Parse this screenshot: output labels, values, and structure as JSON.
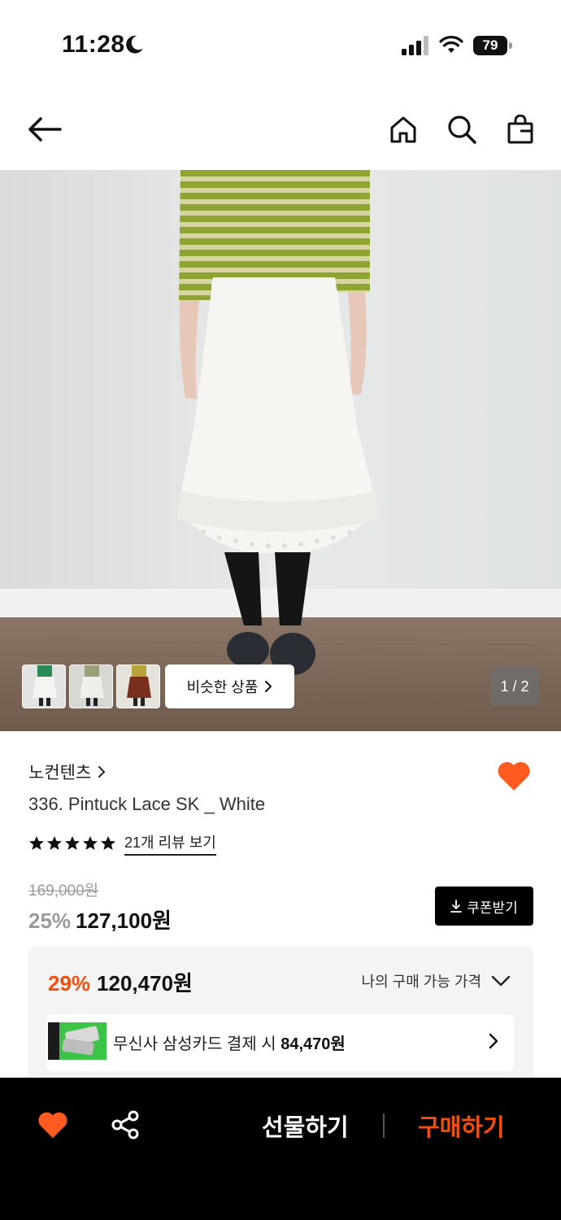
{
  "status_bar": {
    "time": "11:28",
    "battery": "79",
    "icons": [
      "moon-icon",
      "signal-icon",
      "wifi-icon",
      "battery-icon"
    ]
  },
  "nav": {
    "icons": [
      "back-arrow-icon",
      "home-icon",
      "search-icon",
      "shopping-bag-icon"
    ]
  },
  "gallery": {
    "similar_label": "비슷한 상품",
    "pager": "1 / 2",
    "thumbnail_count": 3
  },
  "product": {
    "brand": "노컨텐츠",
    "title": "336. Pintuck Lace SK _ White",
    "rating_stars": 5,
    "review_link": "21개 리뷰 보기",
    "original_price": "169,000원",
    "discount_rate": "25%",
    "sale_price": "127,100원",
    "coupon_label": "쿠폰받기"
  },
  "best_price": {
    "rate": "29%",
    "price": "120,470원",
    "toggle_label": "나의 구매 가능 가격",
    "card_offer_prefix": "무신사 삼성카드 결제 시 ",
    "card_offer_price": "84,470원"
  },
  "bottom_bar": {
    "gift_label": "선물하기",
    "buy_label": "구매하기"
  },
  "colors": {
    "accent": "#f04f0e",
    "heart": "#ff5a1f",
    "black": "#000000"
  }
}
